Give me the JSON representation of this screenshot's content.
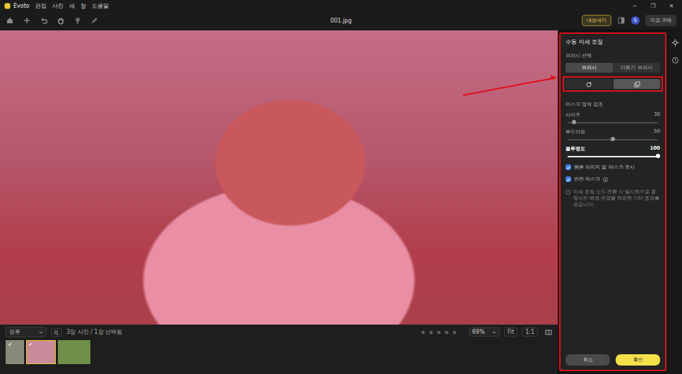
{
  "app": {
    "logo": "Evoto",
    "menus": [
      "편집",
      "사진",
      "새",
      "창",
      "도움말"
    ]
  },
  "window": {
    "title": "001.jpg",
    "controls": [
      "─",
      "❐",
      "✕"
    ]
  },
  "toolbar": {
    "export": "내보내기",
    "avatar": "S",
    "buy": "지금 구매"
  },
  "panel": {
    "title": "수동 미세 조정",
    "brush_label": "브러시 선택",
    "brush_tabs": [
      {
        "label": "브러시",
        "selected": true
      },
      {
        "label": "다듬기 브러시",
        "selected": false
      }
    ],
    "brush_modes": [
      {
        "kind": "add",
        "selected": false
      },
      {
        "kind": "subtract",
        "selected": true
      }
    ],
    "highlight_label": "마스크 영역 강조",
    "sliders": [
      {
        "label": "사이즈",
        "value": "30",
        "level": 0.07,
        "emphasized": false
      },
      {
        "label": "부드러움",
        "value": "50",
        "level": 0.5,
        "emphasized": false
      },
      {
        "label": "불투명도",
        "value": "100",
        "level": 1,
        "emphasized": true
      }
    ],
    "checkboxes": [
      {
        "label": "원본 이미지 및 마스크 표시",
        "checked": true,
        "info": false
      },
      {
        "label": "반전 마스크",
        "checked": true,
        "info": true
      }
    ],
    "note": "미세 조정 모드 전환 시 일시적으로 증명사진 배경 변경을 제외한 기타 효과를 숨깁니다.",
    "buttons": [
      {
        "label": "취소",
        "primary": false
      },
      {
        "label": "확인",
        "primary": true
      }
    ]
  },
  "filmstrip": {
    "filter": "모두",
    "count": "3장 사진 / 1장 선택됨",
    "star": "★",
    "stars": 0,
    "zoom": "69%",
    "fit": "Fit",
    "ratio": "1:1",
    "thumbnails": [
      {
        "selected": false,
        "edited": true,
        "color": "#8a8a7a"
      },
      {
        "selected": true,
        "edited": true,
        "color": "#c98a9a"
      },
      {
        "selected": false,
        "edited": false,
        "color": "#6f8f4a"
      }
    ]
  }
}
